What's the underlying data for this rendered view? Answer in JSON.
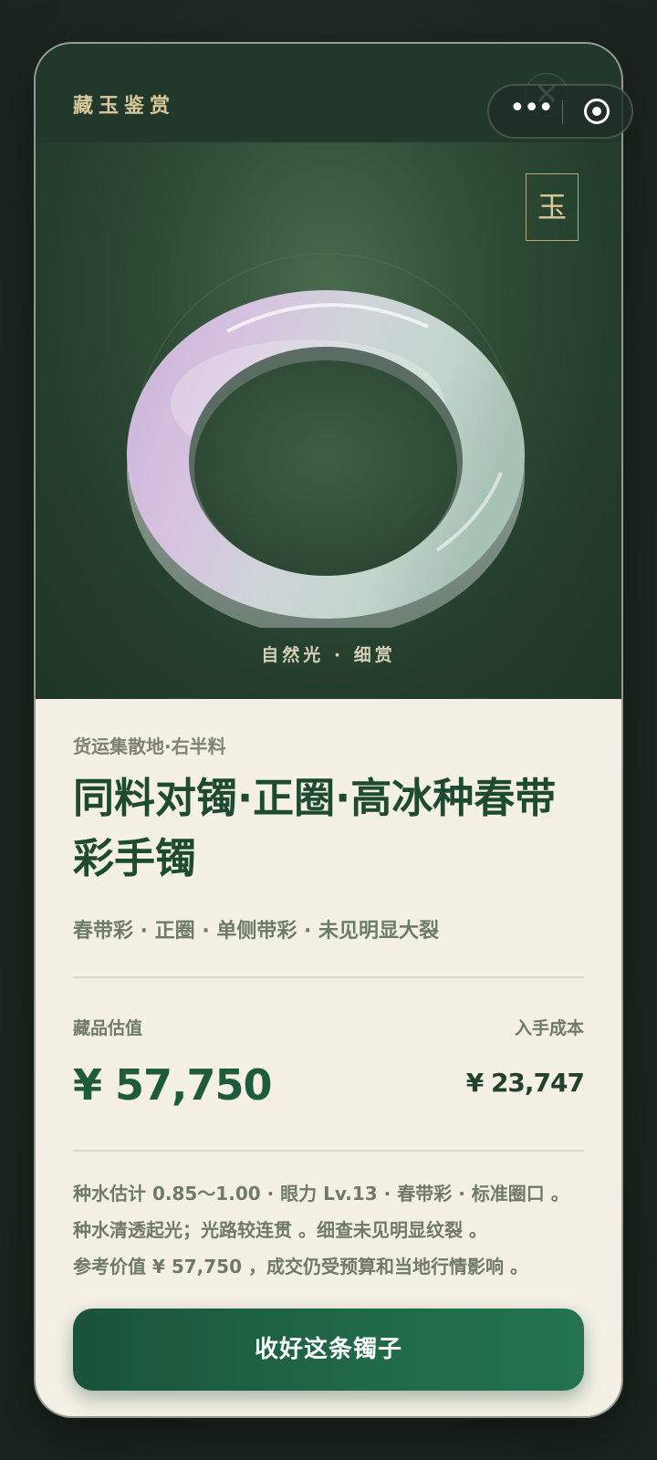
{
  "brand": "藏玉鉴赏",
  "seal_char": "玉",
  "hero_caption": "自然光 · 细赏",
  "origin": "货运集散地·右半料",
  "title": "同料对镯·正圈·高冰种春带彩手镯",
  "tags": "春带彩 · 正圈 · 单侧带彩 · 未见明显大裂",
  "valuation": {
    "label": "藏品估值",
    "value": "¥ 57,750"
  },
  "cost": {
    "label": "入手成本",
    "value": "¥ 23,747"
  },
  "notes": [
    "种水估计 0.85～1.00 · 眼力 Lv.13 · 春带彩 · 标准圈口 。",
    "种水清透起光；光路较连贯 。细查未见明显纹裂 。",
    "参考价值 ¥ 57,750 ，成交仍受预算和当地行情影响 。"
  ],
  "cta_label": "收好这条镯子",
  "capsule": {
    "more_glyph": "•••",
    "close_glyph": "✕"
  },
  "colors": {
    "accent": "#1e5a3c",
    "hero_bg": "#2f4d37",
    "gold": "#d9c89b",
    "card_bg": "#f4f0e5"
  }
}
